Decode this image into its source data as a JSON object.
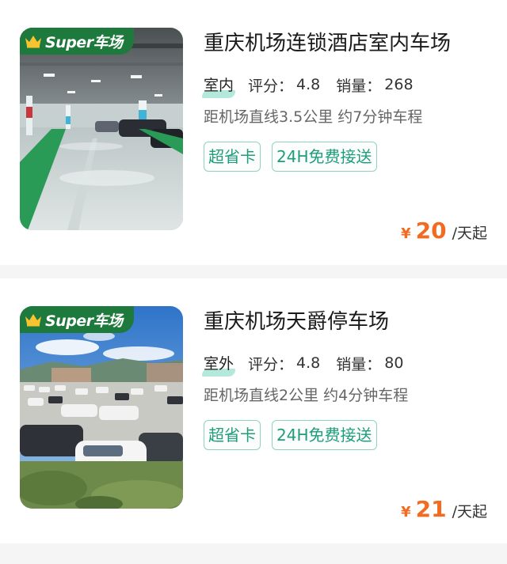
{
  "badge_text": "Super车场",
  "lots": [
    {
      "name": "重庆机场连锁酒店室内车场",
      "type": "室内",
      "rating_label": "评分：",
      "rating": "4.8",
      "sales_label": "销量：",
      "sales": "268",
      "distance": "距机场直线3.5公里 约7分钟车程",
      "tags": [
        "超省卡",
        "24H免费接送"
      ],
      "currency": "¥",
      "price": "20",
      "price_unit": "/天起"
    },
    {
      "name": "重庆机场天爵停车场",
      "type": "室外",
      "rating_label": "评分：",
      "rating": "4.8",
      "sales_label": "销量：",
      "sales": "80",
      "distance": "距机场直线2公里 约4分钟车程",
      "tags": [
        "超省卡",
        "24H免费接送"
      ],
      "currency": "¥",
      "price": "21",
      "price_unit": "/天起"
    }
  ],
  "colors": {
    "badge": "#1e7a3c",
    "price": "#f26b21",
    "tag": "#1f9d7a",
    "tag_border": "#8fd3bf"
  }
}
